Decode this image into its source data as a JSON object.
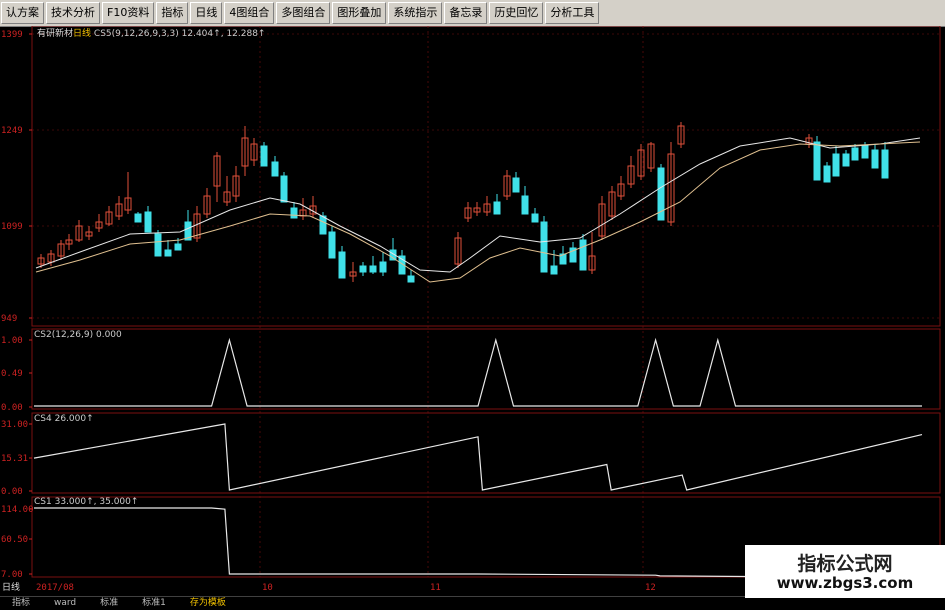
{
  "toolbar": {
    "items": [
      "认方案",
      "技术分析",
      "F10资料",
      "指标",
      "日线",
      "4图组合",
      "多图组合",
      "图形叠加",
      "系统指示",
      "备忘录",
      "历史回忆",
      "分析工具"
    ]
  },
  "main_panel": {
    "stock_name": "有研新材",
    "period": "日线",
    "indicator": "CS5(9,12,26,9,3,3)",
    "value1": "12.404↑",
    "value2": "12.288↑",
    "y_ticks": [
      "1399",
      "1249",
      "1099",
      "949"
    ]
  },
  "panel_cs2": {
    "label": "CS2(12,26,9)",
    "value": "0.000",
    "y_ticks": [
      "1.00",
      "0.49",
      "0.00"
    ]
  },
  "panel_cs4": {
    "label": "CS4",
    "value": "26.000↑",
    "y_ticks": [
      "31.00",
      "15.31",
      "0.00"
    ]
  },
  "panel_cs1": {
    "label": "CS1",
    "value1": "33.000↑,",
    "value2": "35.000↑",
    "y_ticks": [
      "114.00",
      "60.50",
      "7.00"
    ]
  },
  "time_axis": {
    "period_label": "日线",
    "date_start": "2017/08",
    "months": [
      "10",
      "11",
      "12"
    ]
  },
  "tabs": [
    "指标",
    "ward",
    "标准",
    "标准1",
    "存为模板"
  ],
  "watermark": {
    "title": "指标公式网",
    "url": "www.zbgs3.com"
  },
  "colors": {
    "up": "#e0503a",
    "down": "#40e0e8",
    "grid": "#7a1010",
    "axis_text": "#cc2222",
    "line": "#e8e8e8"
  },
  "chart_data": [
    {
      "type": "line",
      "name": "CS2",
      "x": [
        0,
        20,
        40,
        44,
        48,
        60,
        100,
        104,
        108,
        130,
        136,
        140,
        144,
        150,
        154,
        158,
        200
      ],
      "y": [
        0,
        0,
        0,
        1,
        0,
        0,
        0,
        1,
        0,
        0,
        0,
        1,
        0,
        0,
        1,
        0,
        0
      ],
      "ylim": [
        0,
        1
      ]
    },
    {
      "type": "line",
      "name": "CS4",
      "x": [
        0,
        43,
        44,
        100,
        101,
        129,
        130,
        146,
        147,
        200
      ],
      "y": [
        15,
        31,
        0,
        25,
        0,
        12,
        0,
        7,
        0,
        26
      ],
      "ylim": [
        0,
        31
      ]
    },
    {
      "type": "line",
      "name": "CS1",
      "x": [
        0,
        40,
        43,
        44,
        100,
        140,
        141,
        160,
        200
      ],
      "y": [
        114,
        114,
        112,
        7,
        7,
        5,
        4,
        3,
        3
      ],
      "ylim": [
        7,
        114
      ]
    }
  ]
}
